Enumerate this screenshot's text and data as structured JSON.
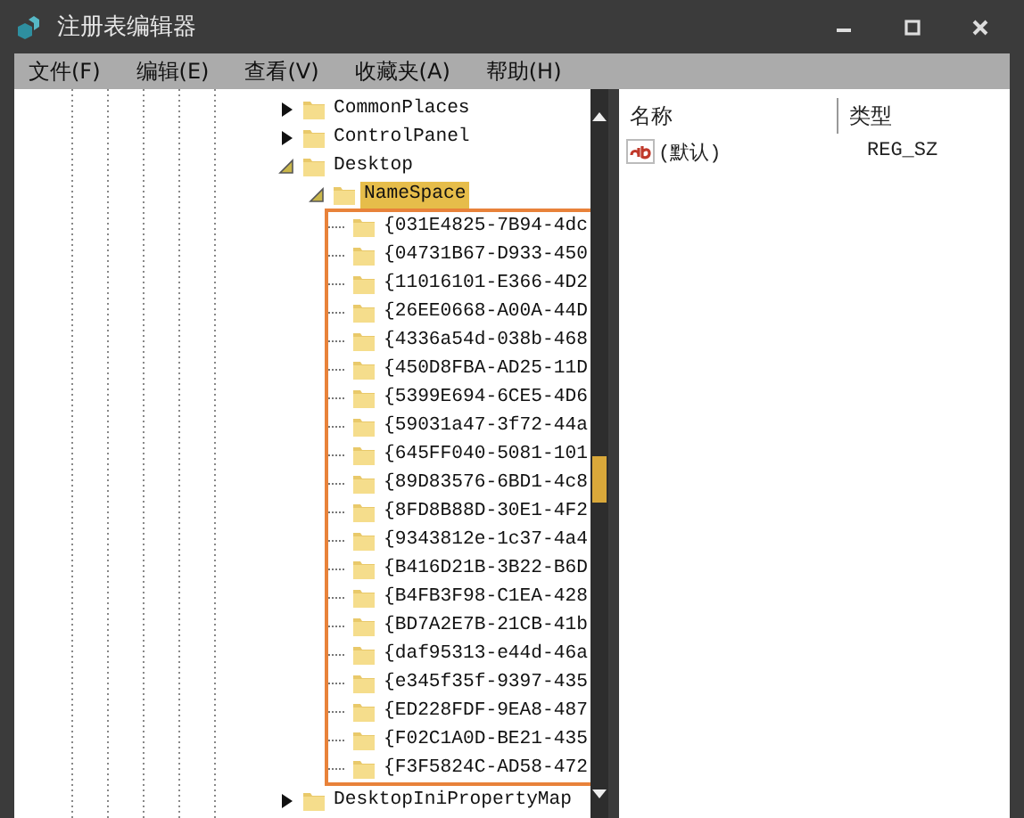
{
  "window": {
    "title": "注册表编辑器"
  },
  "menu": [
    "文件(F)",
    "编辑(E)",
    "查看(V)",
    "收藏夹(A)",
    "帮助(H)"
  ],
  "tree": [
    {
      "label": "CommonPlaces",
      "expanded": false,
      "selected": false
    },
    {
      "label": "ControlPanel",
      "expanded": false,
      "selected": false
    },
    {
      "label": "Desktop",
      "expanded": true,
      "selected": false,
      "children": [
        {
          "label": "NameSpace",
          "expanded": true,
          "selected": true,
          "children_outlined": true,
          "children": [
            {
              "label": "{031E4825-7B94-4dc",
              "selected": false
            },
            {
              "label": "{04731B67-D933-450",
              "selected": false
            },
            {
              "label": "{11016101-E366-4D2",
              "selected": false
            },
            {
              "label": "{26EE0668-A00A-44D",
              "selected": false
            },
            {
              "label": "{4336a54d-038b-468",
              "selected": false
            },
            {
              "label": "{450D8FBA-AD25-11D",
              "selected": false
            },
            {
              "label": "{5399E694-6CE5-4D6",
              "selected": false
            },
            {
              "label": "{59031a47-3f72-44a",
              "selected": false
            },
            {
              "label": "{645FF040-5081-101",
              "selected": false
            },
            {
              "label": "{89D83576-6BD1-4c8",
              "selected": false
            },
            {
              "label": "{8FD8B88D-30E1-4F2",
              "selected": false
            },
            {
              "label": "{9343812e-1c37-4a4",
              "selected": false
            },
            {
              "label": "{B416D21B-3B22-B6D",
              "selected": false
            },
            {
              "label": "{B4FB3F98-C1EA-428",
              "selected": false
            },
            {
              "label": "{BD7A2E7B-21CB-41b",
              "selected": false
            },
            {
              "label": "{daf95313-e44d-46a",
              "selected": false
            },
            {
              "label": "{e345f35f-9397-435",
              "selected": false
            },
            {
              "label": "{ED228FDF-9EA8-487",
              "selected": false
            },
            {
              "label": "{F02C1A0D-BE21-435",
              "selected": false
            },
            {
              "label": "{F3F5824C-AD58-472",
              "selected": false
            }
          ]
        }
      ]
    },
    {
      "label": "DesktopIniPropertyMap",
      "expanded": false,
      "selected": false
    }
  ],
  "values": {
    "columns": [
      "名称",
      "类型"
    ],
    "rows": [
      {
        "name": "(默认)",
        "type": "REG_SZ"
      }
    ]
  }
}
